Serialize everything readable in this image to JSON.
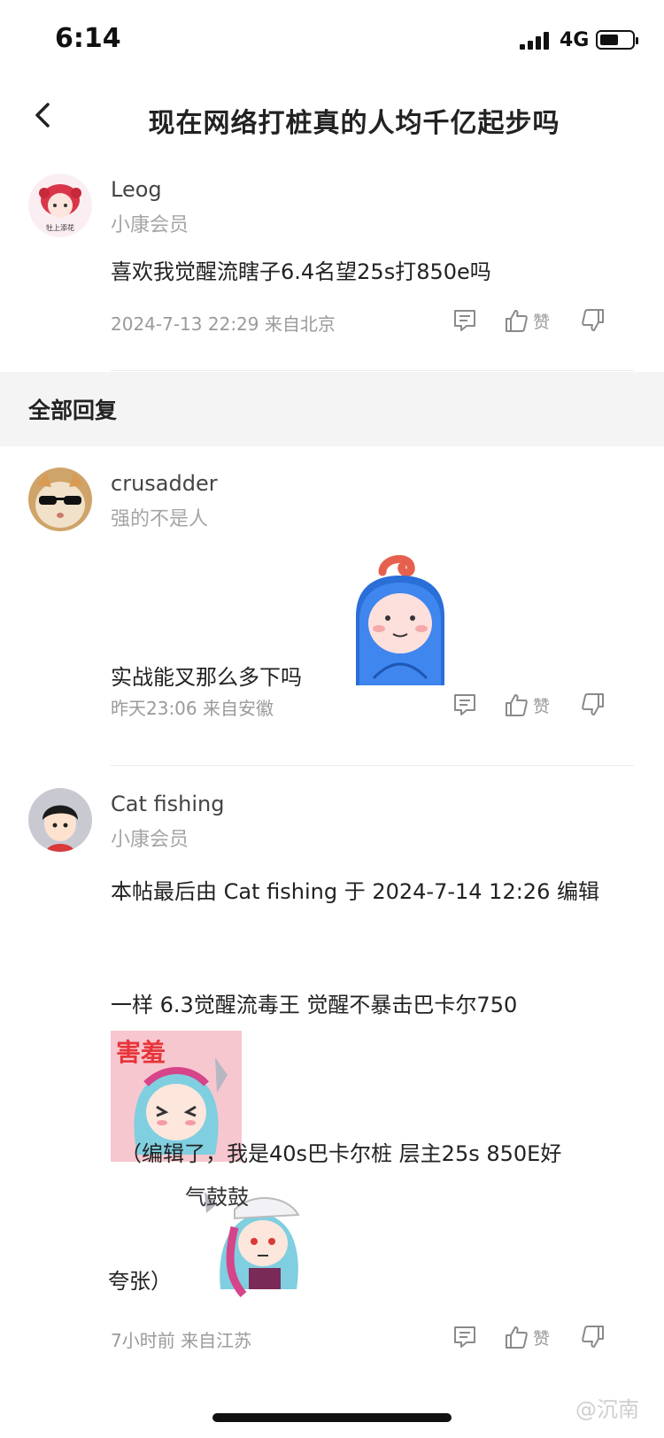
{
  "status_bar": {
    "time": "6:14",
    "network": "4G",
    "battery_level": 0.6
  },
  "header": {
    "title": "现在网络打桩真的人均千亿起步吗",
    "back_icon": "chevron-left-icon"
  },
  "original_post": {
    "username": "Leog",
    "role": "小康会员",
    "avatar_text": "牡上添花",
    "content": "喜欢我觉醒流瞎子6.4名望25s打850e吗",
    "meta": "2024-7-13 22:29 来自北京",
    "like_label": "赞"
  },
  "section": {
    "label": "全部回复"
  },
  "replies": [
    {
      "username": "crusadder",
      "role": "强的不是人",
      "content": "实战能叉那么多下吗",
      "meta": "昨天23:06 来自安徽",
      "like_label": "赞"
    },
    {
      "username": "Cat fishing",
      "role": "小康会员",
      "edit_note": "本帖最后由 Cat fishing 于 2024-7-14 12:26 编辑",
      "line1": "一样 6.3觉醒流毒王 觉醒不暴击巴卡尔750",
      "sticker1_text": "害羞",
      "line2": "（编辑了，我是40s巴卡尔桩   层主25s 850E好",
      "sticker2_text": "气鼓鼓",
      "line3": "夸张）",
      "meta": "7小时前 来自江苏",
      "like_label": "赞"
    }
  ],
  "watermark": "@沉南",
  "colors": {
    "text_primary": "#222222",
    "text_secondary": "#9a9a9a",
    "section_bg": "#f4f4f4",
    "divider": "#ececec"
  }
}
